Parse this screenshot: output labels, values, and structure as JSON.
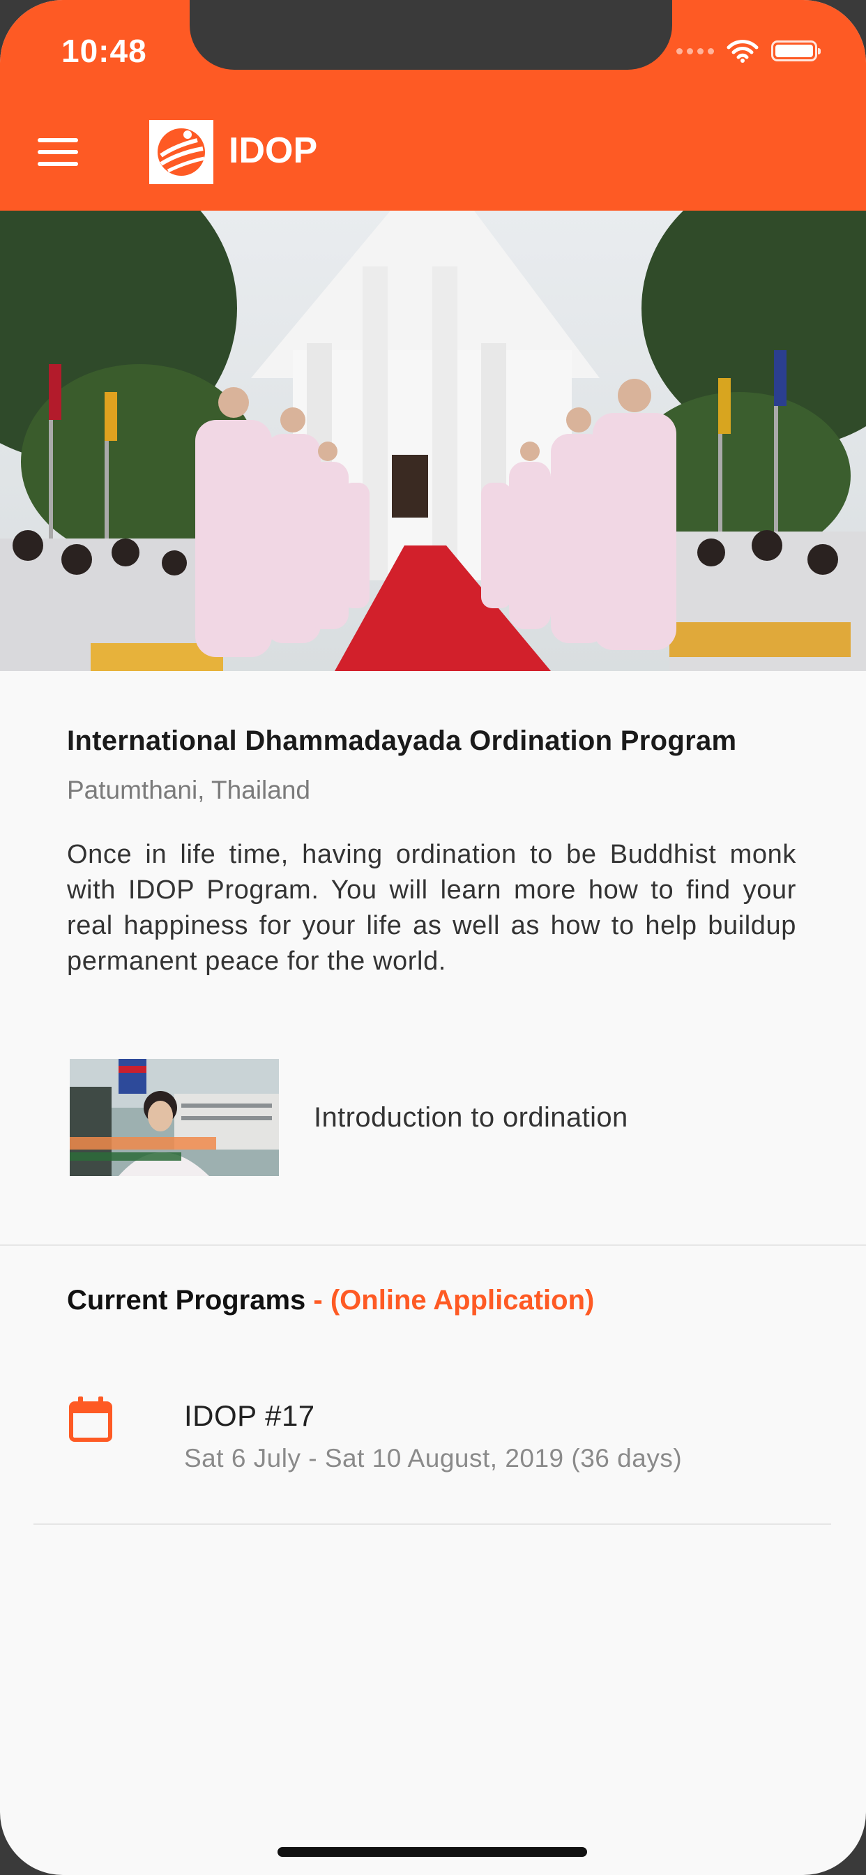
{
  "status_bar": {
    "time": "10:48"
  },
  "app_bar": {
    "title": "IDOP"
  },
  "program": {
    "title": "International Dhammadayada Ordination Program",
    "location": "Patumthani, Thailand",
    "description": "Once in life time, having ordination to be Buddhist monk with IDOP Program. You will learn more how to find your real happiness for your life as well as how to help buildup permanent peace for the world."
  },
  "video": {
    "label": "Introduction to ordination"
  },
  "current_programs": {
    "heading": "Current Programs",
    "heading_accent": " - (Online Application)",
    "items": [
      {
        "name": "IDOP #17",
        "dates": "Sat 6 July - Sat 10 August, 2019 (36 days)"
      }
    ]
  },
  "colors": {
    "accent": "#fe5a24",
    "background": "#f9f9f9"
  },
  "icons": [
    "menu-icon",
    "logo-icon",
    "wifi-icon",
    "battery-icon",
    "calendar-icon"
  ]
}
